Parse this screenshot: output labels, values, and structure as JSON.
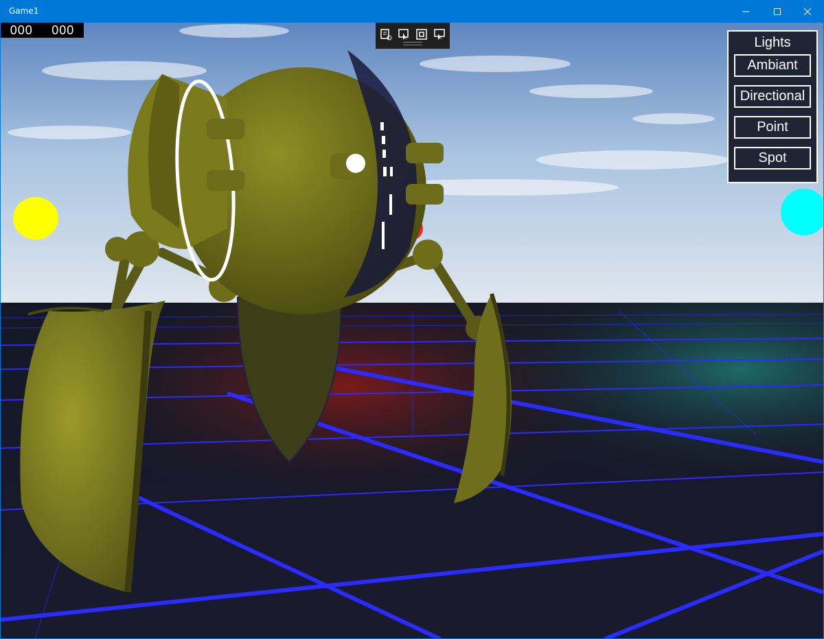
{
  "window": {
    "title": "Game1",
    "titlebar_color": "#0078d7",
    "controls": [
      "minimize-icon",
      "maximize-icon",
      "close-icon"
    ]
  },
  "hud": {
    "counter_left": "000",
    "counter_right": "000"
  },
  "devtools": {
    "tools": [
      "live-visual-tree-icon",
      "select-element-icon",
      "display-layout-adorners-icon",
      "track-focused-element-icon"
    ]
  },
  "lights_panel": {
    "title": "Lights",
    "buttons": [
      "Ambiant",
      "Directional",
      "Point",
      "Spot"
    ]
  },
  "scene": {
    "sky_color": "#6f95c8",
    "grid_color": "#2b2bff",
    "robot_color": "#8a8a1e",
    "light_spheres": [
      {
        "name": "yellow-light-sphere",
        "color": "#ffff00"
      },
      {
        "name": "cyan-light-sphere",
        "color": "#00ffff"
      },
      {
        "name": "red-light-sphere",
        "color": "#ff2020"
      }
    ]
  }
}
